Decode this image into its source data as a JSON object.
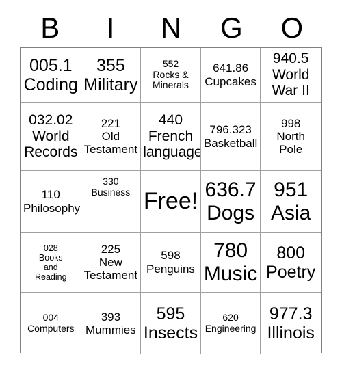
{
  "card": {
    "header_letters": [
      "B",
      "I",
      "N",
      "G",
      "O"
    ],
    "rows": [
      [
        {
          "lines": [
            "005.1",
            "Coding"
          ],
          "size": "lg",
          "align": "center",
          "free": false
        },
        {
          "lines": [
            "355",
            "Military"
          ],
          "size": "lg",
          "align": "center",
          "free": false
        },
        {
          "lines": [
            "552",
            "Rocks &",
            "Minerals"
          ],
          "size": "xs",
          "align": "center",
          "free": false
        },
        {
          "lines": [
            "641.86",
            "Cupcakes"
          ],
          "size": "sm",
          "align": "center",
          "free": false
        },
        {
          "lines": [
            "940.5",
            "World",
            "War II"
          ],
          "size": "md",
          "align": "center",
          "free": false
        }
      ],
      [
        {
          "lines": [
            "032.02",
            "World",
            "Records"
          ],
          "size": "md",
          "align": "center",
          "free": false
        },
        {
          "lines": [
            "221",
            "Old",
            "Testament"
          ],
          "size": "sm",
          "align": "center",
          "free": false
        },
        {
          "lines": [
            "440",
            "French",
            "language"
          ],
          "size": "md",
          "align": "center",
          "free": false
        },
        {
          "lines": [
            "796.323",
            "Basketball"
          ],
          "size": "sm",
          "align": "center",
          "free": false
        },
        {
          "lines": [
            "998",
            "North",
            "Pole"
          ],
          "size": "sm",
          "align": "center",
          "free": false
        }
      ],
      [
        {
          "lines": [
            "110",
            "Philosophy"
          ],
          "size": "sm",
          "align": "center",
          "free": false
        },
        {
          "lines": [
            "330",
            "Business"
          ],
          "size": "xs",
          "align": "top",
          "free": false
        },
        {
          "lines": [
            "Free!"
          ],
          "size": "free",
          "align": "center",
          "free": true
        },
        {
          "lines": [
            "636.7",
            "Dogs"
          ],
          "size": "xl",
          "align": "center",
          "free": false
        },
        {
          "lines": [
            "951",
            "Asia"
          ],
          "size": "xl",
          "align": "center",
          "free": false
        }
      ],
      [
        {
          "lines": [
            "028",
            "Books",
            "and",
            "Reading"
          ],
          "size": "xxs",
          "align": "center",
          "free": false
        },
        {
          "lines": [
            "225",
            "New",
            "Testament"
          ],
          "size": "sm",
          "align": "center",
          "free": false
        },
        {
          "lines": [
            "598",
            "Penguins"
          ],
          "size": "sm",
          "align": "center",
          "free": false
        },
        {
          "lines": [
            "780",
            "Music"
          ],
          "size": "xl",
          "align": "center",
          "free": false
        },
        {
          "lines": [
            "800",
            "Poetry"
          ],
          "size": "lg",
          "align": "center",
          "free": false
        }
      ],
      [
        {
          "lines": [
            "004",
            "Computers"
          ],
          "size": "xs",
          "align": "center",
          "free": false
        },
        {
          "lines": [
            "393",
            "Mummies"
          ],
          "size": "sm",
          "align": "center",
          "free": false
        },
        {
          "lines": [
            "595",
            "Insects"
          ],
          "size": "lg",
          "align": "center",
          "free": false
        },
        {
          "lines": [
            "620",
            "Engineering"
          ],
          "size": "xs",
          "align": "center",
          "free": false
        },
        {
          "lines": [
            "977.3",
            "Illinois"
          ],
          "size": "lg",
          "align": "center",
          "free": false
        }
      ]
    ]
  },
  "colors": {
    "background": "#ffffff",
    "text": "#000000",
    "grid_border": "#808080",
    "cell_border": "#a0a0a0"
  }
}
